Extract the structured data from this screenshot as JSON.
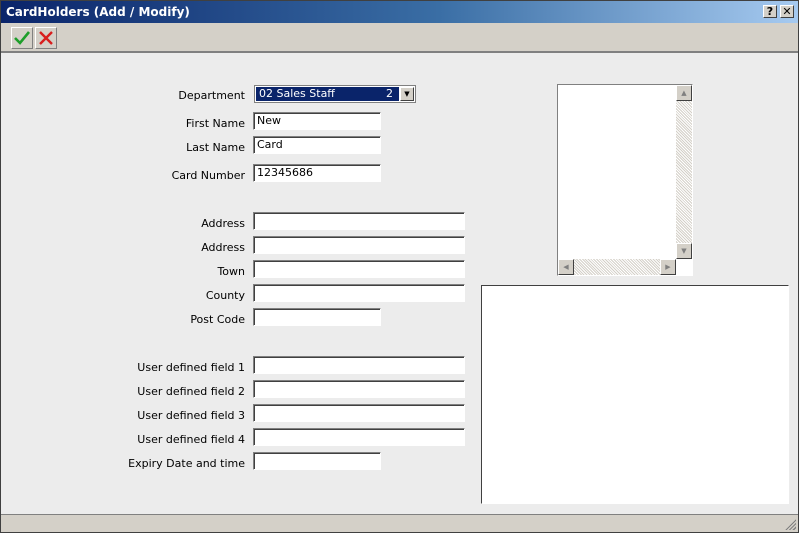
{
  "window": {
    "title": "CardHolders (Add / Modify)",
    "help_label": "?",
    "close_label": "✕"
  },
  "toolbar": {
    "ok_icon": "checkmark-icon",
    "cancel_icon": "cross-icon",
    "ok_color": "#1e9e2a",
    "cancel_color": "#d81e1e"
  },
  "form": {
    "department": {
      "label": "Department",
      "value": "02 Sales Staff",
      "code": "2"
    },
    "first_name": {
      "label": "First Name",
      "value": "New"
    },
    "last_name": {
      "label": "Last Name",
      "value": "Card"
    },
    "card_number": {
      "label": "Card Number",
      "value": "12345686"
    },
    "address1": {
      "label": "Address",
      "value": ""
    },
    "address2": {
      "label": "Address",
      "value": ""
    },
    "town": {
      "label": "Town",
      "value": ""
    },
    "county": {
      "label": "County",
      "value": ""
    },
    "post_code": {
      "label": "Post Code",
      "value": ""
    },
    "udf1": {
      "label": "User defined field 1",
      "value": ""
    },
    "udf2": {
      "label": "User defined field 2",
      "value": ""
    },
    "udf3": {
      "label": "User defined field 3",
      "value": ""
    },
    "udf4": {
      "label": "User defined field 4",
      "value": ""
    },
    "expiry": {
      "label": "Expiry Date and time",
      "value": ""
    }
  },
  "colors": {
    "selection": "#0a246a",
    "title_start": "#0a246a",
    "title_end": "#a6caf0"
  }
}
